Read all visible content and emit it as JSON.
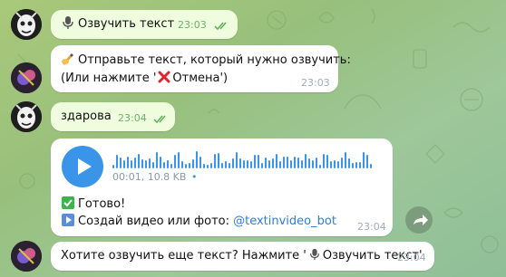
{
  "colors": {
    "outgoing_bubble": "#effdde",
    "incoming_bubble": "#ffffff",
    "accent": "#3a95e8",
    "link": "#2f7ed8",
    "outgoing_time": "#6fb169",
    "incoming_time": "#a0acb6"
  },
  "messages": [
    {
      "direction": "outgoing",
      "emoji": "microphone",
      "text": "Озвучить текст",
      "time": "23:03",
      "status": "read"
    },
    {
      "direction": "incoming",
      "line1_emoji": "writing-hand",
      "line1": "Отправьте текст, который нужно озвучить:",
      "line2_prefix": "(Или нажмите '",
      "line2_emoji": "cross-mark",
      "line2_suffix": "Отмена')",
      "time": "23:03"
    },
    {
      "direction": "outgoing",
      "text": "здарова",
      "time": "23:04",
      "status": "read"
    },
    {
      "direction": "incoming",
      "voice": {
        "meta": "00:01, 10.8 KB",
        "dot": "•"
      },
      "line1_emoji": "check-mark-button",
      "line1": "Готово!",
      "line2_emoji": "play-button",
      "line2_prefix": "Создай видео или фото: ",
      "link": "@textinvideo_bot",
      "time": "23:04"
    },
    {
      "direction": "incoming",
      "prefix": "Хотите озвучить еще текст? Нажмите '",
      "emoji": "microphone",
      "suffix": "Озвучить текст'",
      "time": "23:04"
    }
  ]
}
